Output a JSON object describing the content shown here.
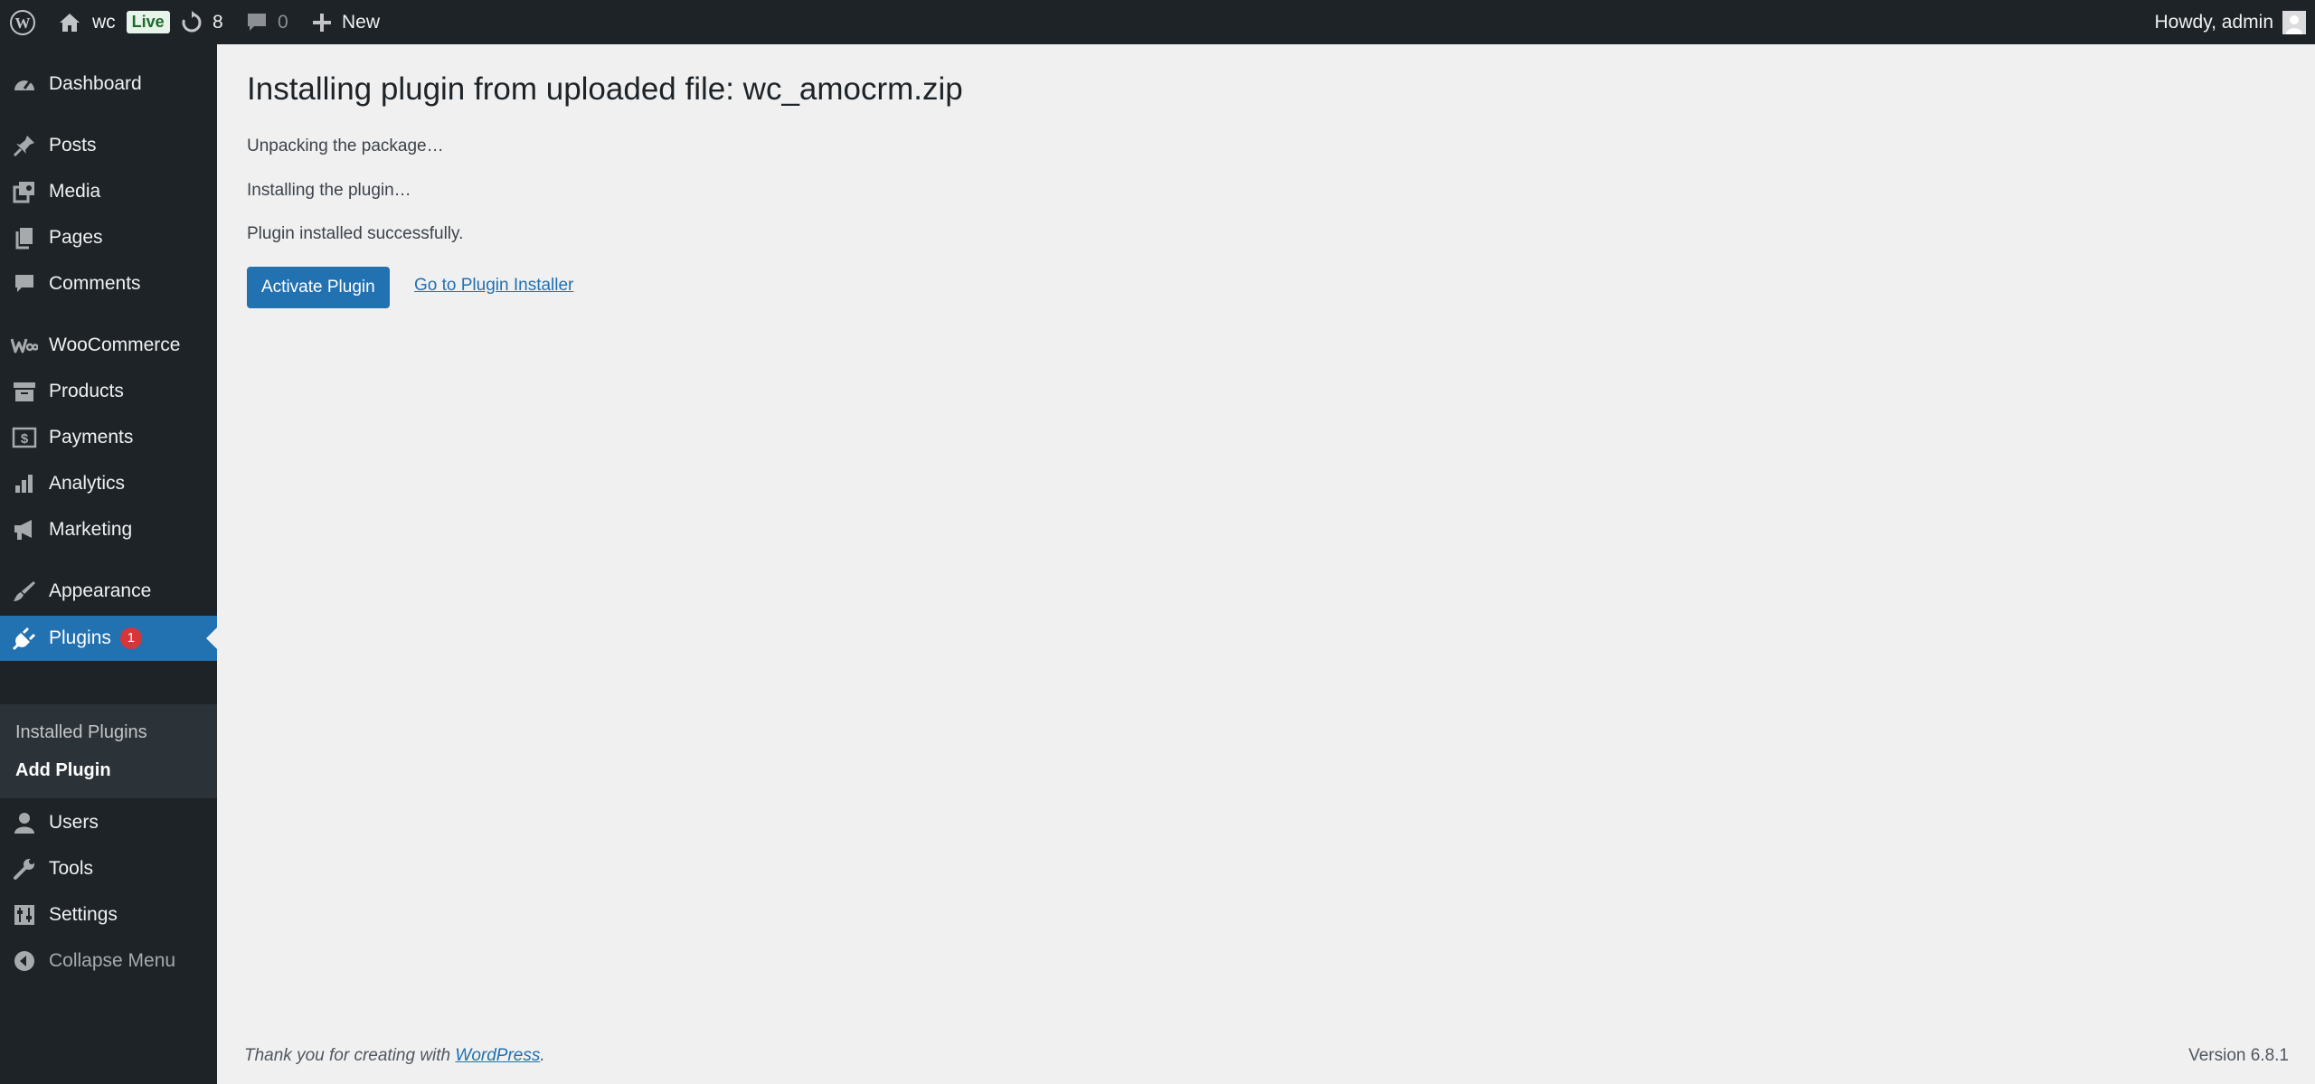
{
  "adminbar": {
    "site_name": "wc",
    "live_label": "Live",
    "updates_count": "8",
    "comments_count": "0",
    "new_label": "New",
    "howdy": "Howdy, admin"
  },
  "sidebar": {
    "items": [
      {
        "label": "Dashboard",
        "icon": "dashboard-icon"
      },
      {
        "label": "Posts",
        "icon": "pin-icon"
      },
      {
        "label": "Media",
        "icon": "media-icon"
      },
      {
        "label": "Pages",
        "icon": "pages-icon"
      },
      {
        "label": "Comments",
        "icon": "comment-icon"
      },
      {
        "label": "WooCommerce",
        "icon": "woo-icon"
      },
      {
        "label": "Products",
        "icon": "archive-icon"
      },
      {
        "label": "Payments",
        "icon": "dollar-icon"
      },
      {
        "label": "Analytics",
        "icon": "bar-chart-icon"
      },
      {
        "label": "Marketing",
        "icon": "megaphone-icon"
      },
      {
        "label": "Appearance",
        "icon": "brush-icon"
      },
      {
        "label": "Plugins",
        "icon": "plugin-icon",
        "badge": "1"
      },
      {
        "label": "Users",
        "icon": "user-icon"
      },
      {
        "label": "Tools",
        "icon": "wrench-icon"
      },
      {
        "label": "Settings",
        "icon": "sliders-icon"
      },
      {
        "label": "Collapse Menu",
        "icon": "collapse-icon"
      }
    ],
    "submenu": [
      {
        "label": "Installed Plugins"
      },
      {
        "label": "Add Plugin"
      }
    ]
  },
  "main": {
    "title": "Installing plugin from uploaded file: wc_amocrm.zip",
    "messages": [
      "Unpacking the package…",
      "Installing the plugin…",
      "Plugin installed successfully."
    ],
    "activate_button": "Activate Plugin",
    "installer_link": "Go to Plugin Installer"
  },
  "footer": {
    "thanks_prefix": "Thank you for creating with ",
    "wordpress_link": "WordPress",
    "thanks_suffix": ".",
    "version": "Version 6.8.1"
  },
  "colors": {
    "adminbar_bg": "#1d2327",
    "accent": "#2271b1",
    "badge": "#d63638",
    "content_bg": "#f0f0f1"
  }
}
